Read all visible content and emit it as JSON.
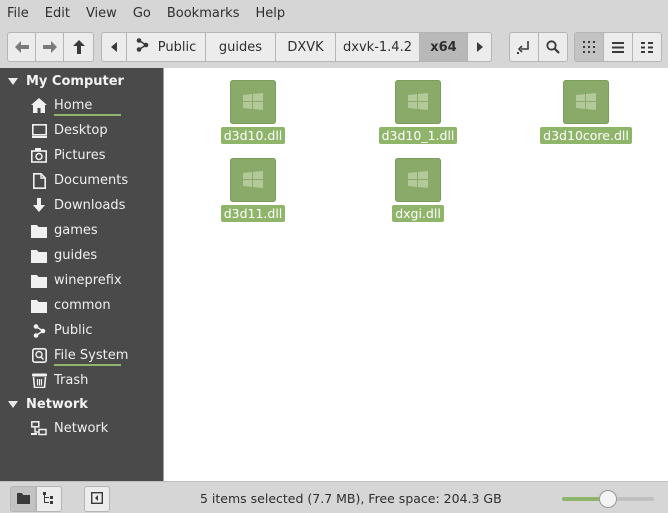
{
  "menubar": {
    "items": [
      "File",
      "Edit",
      "View",
      "Go",
      "Bookmarks",
      "Help"
    ]
  },
  "toolbar": {
    "back_icon": "arrow-left-icon",
    "forward_icon": "arrow-right-icon",
    "up_icon": "arrow-up-icon",
    "breadcrumb_left_icon": "chevron-left-icon",
    "breadcrumb_right_icon": "chevron-right-icon",
    "breadcrumbs": [
      "Public",
      "guides",
      "DXVK",
      "dxvk-1.4.2",
      "x64"
    ],
    "active_crumb": "x64",
    "toggle_location_icon": "location-entry-icon",
    "search_icon": "search-icon",
    "view_icons_icon": "icon-view-icon",
    "view_list_icon": "list-view-icon",
    "view_compact_icon": "compact-view-icon"
  },
  "sidebar": {
    "sections": [
      {
        "title": "My Computer",
        "items": [
          {
            "label": "Home",
            "icon": "home-icon"
          },
          {
            "label": "Desktop",
            "icon": "desktop-icon"
          },
          {
            "label": "Pictures",
            "icon": "pictures-icon"
          },
          {
            "label": "Documents",
            "icon": "documents-icon"
          },
          {
            "label": "Downloads",
            "icon": "downloads-icon"
          },
          {
            "label": "games",
            "icon": "folder-icon"
          },
          {
            "label": "guides",
            "icon": "folder-icon"
          },
          {
            "label": "wineprefix",
            "icon": "folder-icon"
          },
          {
            "label": "common",
            "icon": "folder-icon"
          },
          {
            "label": "Public",
            "icon": "share-icon"
          },
          {
            "label": "File System",
            "icon": "drive-icon"
          },
          {
            "label": "Trash",
            "icon": "trash-icon"
          }
        ]
      },
      {
        "title": "Network",
        "items": [
          {
            "label": "Network",
            "icon": "network-icon"
          }
        ]
      }
    ]
  },
  "files": [
    {
      "name": "d3d10.dll",
      "selected": true
    },
    {
      "name": "d3d10_1.dll",
      "selected": true
    },
    {
      "name": "d3d10core.dll",
      "selected": true
    },
    {
      "name": "d3d11.dll",
      "selected": true
    },
    {
      "name": "dxgi.dll",
      "selected": true
    }
  ],
  "statusbar": {
    "text": "5 items selected (7.7 MB), Free space: 204.3 GB",
    "zoom_level": 0.5
  },
  "colors": {
    "accent": "#8fb56a",
    "sidebar_bg": "#4a4a4a"
  }
}
